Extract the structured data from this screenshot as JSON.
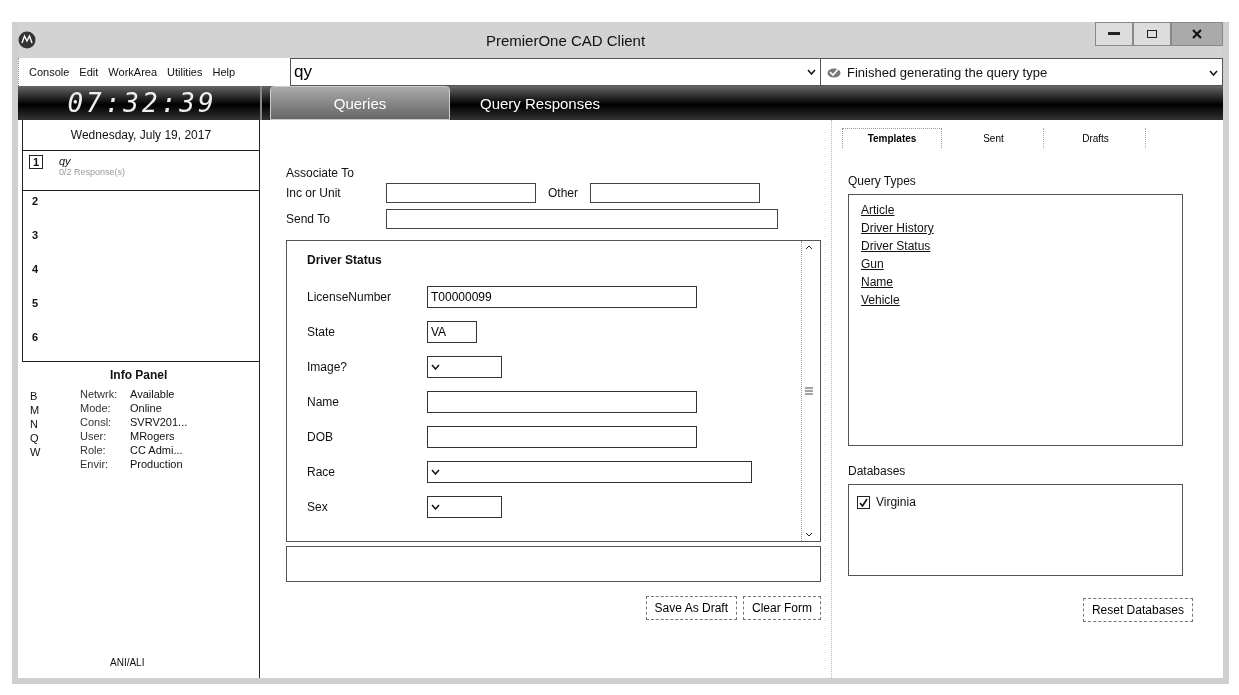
{
  "window": {
    "title": "PremierOne CAD Client"
  },
  "menu": [
    "Console",
    "Edit",
    "WorkArea",
    "Utilities",
    "Help"
  ],
  "command": {
    "value": "qy"
  },
  "status_message": "Finished generating the query type",
  "clock": "07:32:39",
  "date": "Wednesday, July 19, 2017",
  "main_tabs": [
    {
      "label": "Queries",
      "selected": true
    },
    {
      "label": "Query Responses",
      "selected": false
    }
  ],
  "work_areas": [
    {
      "number": "1",
      "title": "qy",
      "subtitle": "0/2 Response(s)",
      "selected": true
    },
    {
      "number": "2",
      "selected": false
    },
    {
      "number": "3",
      "selected": false
    },
    {
      "number": "4",
      "selected": false
    },
    {
      "number": "5",
      "selected": false
    },
    {
      "number": "6",
      "selected": false
    }
  ],
  "info_panel": {
    "title": "Info Panel",
    "keys": [
      "B",
      "M",
      "N",
      "Q",
      "W"
    ],
    "rows": [
      {
        "label": "Netwrk:",
        "value": "Available"
      },
      {
        "label": "Mode:",
        "value": "Online"
      },
      {
        "label": "Consl:",
        "value": "SVRV201..."
      },
      {
        "label": "User:",
        "value": "MRogers"
      },
      {
        "label": "Role:",
        "value": "CC Admi..."
      },
      {
        "label": "Envir:",
        "value": "Production"
      }
    ],
    "footer": "ANI/ALI"
  },
  "associate": {
    "title": "Associate To",
    "inc_label": "Inc or Unit",
    "other_label": "Other",
    "send_label": "Send To"
  },
  "form": {
    "title": "Driver Status",
    "fields": [
      {
        "label": "LicenseNumber",
        "kind": "text",
        "value": "T00000099"
      },
      {
        "label": "State",
        "kind": "code",
        "value": "VA"
      },
      {
        "label": "Image?",
        "kind": "shortselect"
      },
      {
        "label": "Name",
        "kind": "text"
      },
      {
        "label": "DOB",
        "kind": "text"
      },
      {
        "label": "Race",
        "kind": "select"
      },
      {
        "label": "Sex",
        "kind": "shortselect"
      }
    ]
  },
  "form_buttons": [
    "Save As Draft",
    "Clear Form"
  ],
  "side_tabs": [
    {
      "label": "Templates",
      "selected": true
    },
    {
      "label": "Sent",
      "selected": false
    },
    {
      "label": "Drafts",
      "selected": false
    }
  ],
  "query_types": {
    "title": "Query Types",
    "items": [
      "Article",
      "Driver History",
      "Driver Status",
      "Gun",
      "Name",
      "Vehicle"
    ]
  },
  "databases": {
    "title": "Databases",
    "items": [
      {
        "label": "Virginia",
        "checked": true
      }
    ]
  },
  "reset_button": "Reset Databases"
}
